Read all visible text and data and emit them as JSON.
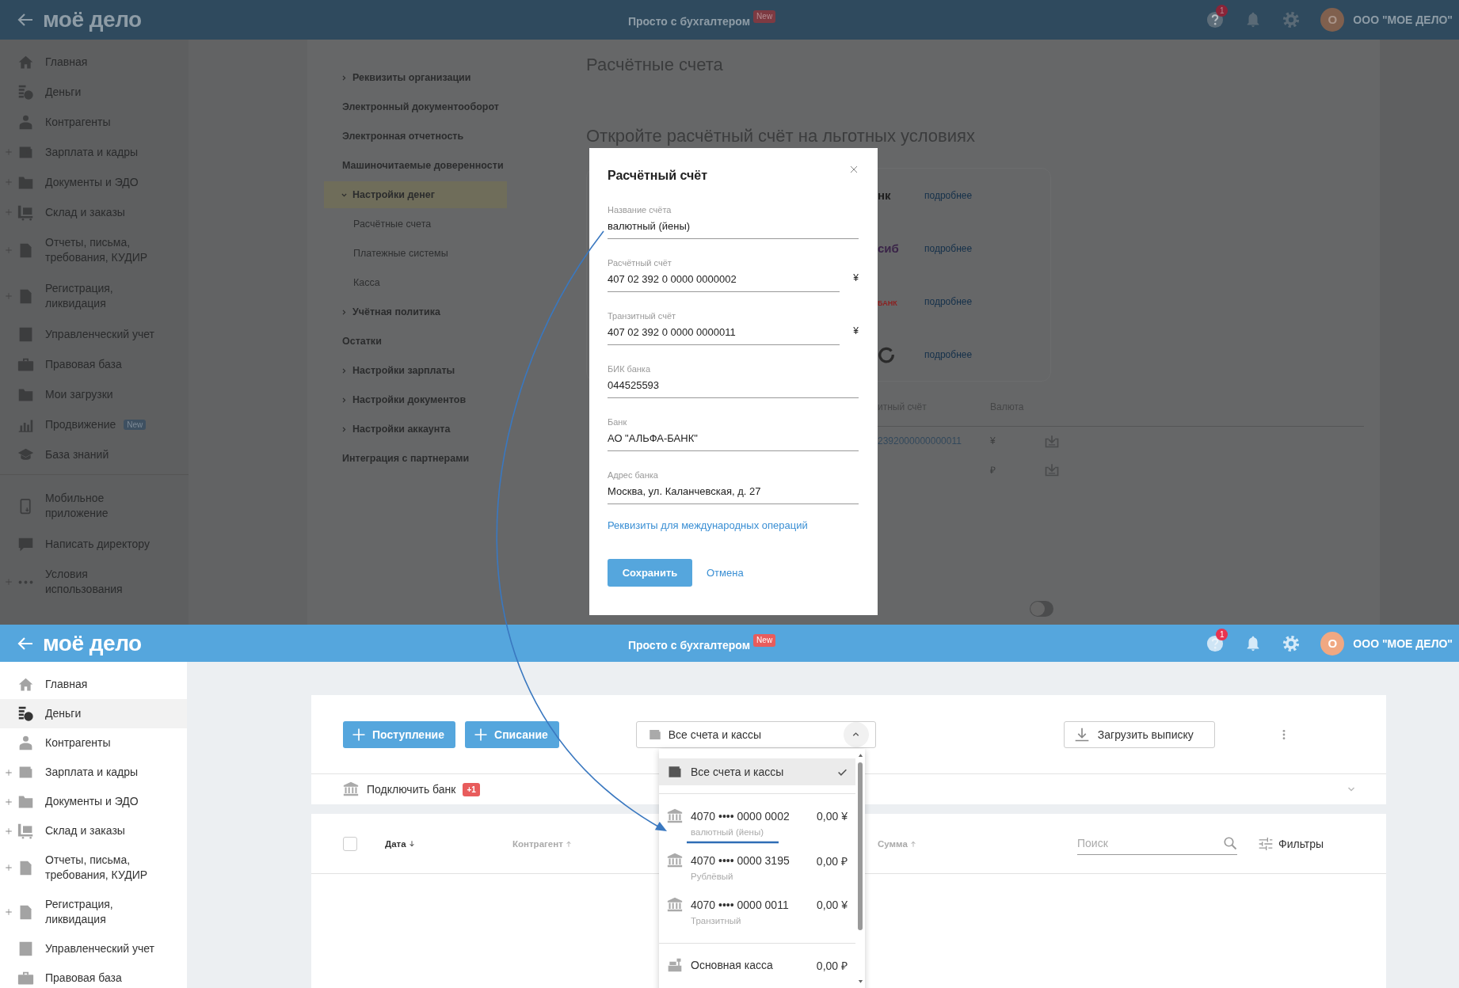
{
  "background_screen": {
    "header": {
      "logo": "моё дело",
      "promo": "Просто с бухгалтером",
      "promo_badge": "New",
      "help_badge": "1",
      "avatar_letter": "О",
      "company": "ООО \"МОЕ ДЕЛО\""
    },
    "sidebar": {
      "items": [
        {
          "label": "Главная",
          "expandable": false
        },
        {
          "label": "Деньги",
          "expandable": false
        },
        {
          "label": "Контрагенты",
          "expandable": false
        },
        {
          "label": "Зарплата и кадры",
          "expandable": true
        },
        {
          "label": "Документы и ЭДО",
          "expandable": true
        },
        {
          "label": "Склад и заказы",
          "expandable": true
        },
        {
          "label": "Отчеты, письма, требования, КУДИР",
          "expandable": true
        },
        {
          "label": "Регистрация, ликвидация",
          "expandable": true
        },
        {
          "label": "Управленческий учет",
          "expandable": false
        },
        {
          "label": "Правовая база",
          "expandable": false
        },
        {
          "label": "Мои загрузки",
          "expandable": false
        },
        {
          "label": "Продвижение",
          "expandable": false,
          "badge": "New"
        },
        {
          "label": "База знаний",
          "expandable": false
        }
      ],
      "footer_items": [
        {
          "label": "Мобильное приложение",
          "expandable": false
        },
        {
          "label": "Написать директору",
          "expandable": false
        },
        {
          "label": "Условия использования",
          "expandable": true
        }
      ]
    },
    "settings_nav": {
      "items": [
        {
          "label": "Реквизиты организации",
          "expanded": false,
          "selected": false
        },
        {
          "label": "Электронный документооборот",
          "selected": false
        },
        {
          "label": "Электронная отчетность",
          "selected": false
        },
        {
          "label": "Машиночитаемые доверенности",
          "selected": false
        },
        {
          "label": "Настройки денег",
          "expanded": true,
          "selected": true,
          "children": [
            {
              "label": "Расчётные счета",
              "selected": false
            },
            {
              "label": "Платежные системы",
              "selected": false
            },
            {
              "label": "Касса",
              "selected": false
            }
          ]
        },
        {
          "label": "Учётная политика",
          "expanded": false,
          "selected": false
        },
        {
          "label": "Остатки",
          "selected": false
        },
        {
          "label": "Настройки зарплаты",
          "expanded": false,
          "selected": false
        },
        {
          "label": "Настройки документов",
          "expanded": false,
          "selected": false
        },
        {
          "label": "Настройки аккаунта",
          "expanded": false,
          "selected": false
        },
        {
          "label": "Интеграция с партнерами",
          "selected": false
        }
      ]
    },
    "page": {
      "title": "Расчётные счета",
      "offer_title": "Откройте расчётный счёт на льготных условиях",
      "bank_offers": [
        {
          "kind": "text",
          "logo": "нк",
          "color": "#1f1f1f",
          "link": "подробнее"
        },
        {
          "kind": "text",
          "logo": "сиб",
          "color": "#3a2448",
          "link": "подробнее"
        },
        {
          "kind": "text",
          "logo": "БАНК",
          "color": "#8b2020",
          "link": "подробнее"
        },
        {
          "kind": "mark",
          "link": "подробнее"
        }
      ],
      "accounts_table": {
        "columns": [
          "итный счёт",
          "Валюта"
        ],
        "rows": [
          {
            "column_2": "2392000000000011",
            "column_3": "¥"
          },
          {
            "column_3": "₽"
          }
        ]
      },
      "toggle_row": {
        "on": false
      }
    }
  },
  "modal": {
    "title": "Расчётный счёт",
    "fields": [
      {
        "label": "Название счёта",
        "value": "валютный (йены)"
      },
      {
        "label": "Расчётный счёт",
        "value": "407 02 392 0 0000 0000002",
        "currency": "¥"
      },
      {
        "label": "Транзитный счёт",
        "value": "407 02 392 0 0000 0000011",
        "currency": "¥"
      },
      {
        "label": "БИК банка",
        "value": "044525593"
      },
      {
        "label": "Банк",
        "value": "АО \"АЛЬФА-БАНК\""
      },
      {
        "label": "Адрес банка",
        "value": "Москва, ул. Каланчевская, д. 27"
      }
    ],
    "link": "Реквизиты для международных операций",
    "save_button": "Сохранить",
    "cancel_button": "Отмена"
  },
  "foreground_screen": {
    "header": {
      "logo": "моё дело",
      "promo": "Просто с бухгалтером",
      "promo_badge": "New",
      "help_badge": "1",
      "avatar_letter": "О",
      "company": "ООО \"МОЕ ДЕЛО\""
    },
    "sidebar": {
      "items": [
        {
          "label": "Главная",
          "expandable": false,
          "selected": false
        },
        {
          "label": "Деньги",
          "expandable": false,
          "selected": true
        },
        {
          "label": "Контрагенты",
          "expandable": false,
          "selected": false
        },
        {
          "label": "Зарплата и кадры",
          "expandable": true,
          "selected": false
        },
        {
          "label": "Документы и ЭДО",
          "expandable": true,
          "selected": false
        },
        {
          "label": "Склад и заказы",
          "expandable": true,
          "selected": false
        },
        {
          "label": "Отчеты, письма, требования, КУДИР",
          "expandable": true,
          "selected": false
        },
        {
          "label": "Регистрация, ликвидация",
          "expandable": true,
          "selected": false
        },
        {
          "label": "Управленческий учет",
          "expandable": false,
          "selected": false
        },
        {
          "label": "Правовая база",
          "expandable": false,
          "selected": false
        }
      ]
    },
    "toolbar": {
      "income_button": "Поступление",
      "expense_button": "Списание",
      "account_select": {
        "value": "Все счета и кассы",
        "expanded": true
      },
      "upload_button": "Загрузить выписку"
    },
    "bank_connect": {
      "label": "Подключить банк",
      "badge": "+1",
      "expanded": false
    },
    "table": {
      "select_all_checked": false,
      "columns": [
        {
          "label": "Дата",
          "sort_descending": true,
          "active": true
        },
        {
          "label": "Контрагент",
          "sort_descending": false,
          "active": false
        },
        {
          "label": "Сумма",
          "sort_descending": false,
          "active": false
        }
      ],
      "search_placeholder": "Поиск",
      "filters_button": "Фильтры"
    },
    "account_menu": {
      "items": [
        {
          "kind": "all",
          "label": "Все счета и кассы",
          "selected": true
        },
        {
          "kind": "account",
          "number": "4070 •••• 0000 0002",
          "amount": "0,00 ¥",
          "note": "валютный (йены)",
          "selected": false
        },
        {
          "kind": "account",
          "number": "4070 •••• 0000 3195",
          "amount": "0,00 ₽",
          "note": "Рублёвый",
          "selected": false
        },
        {
          "kind": "account",
          "number": "4070 •••• 0000 0011",
          "amount": "0,00 ¥",
          "note": "Транзитный",
          "selected": false
        },
        {
          "kind": "cash",
          "label": "Основная касса",
          "amount": "0,00 ₽",
          "selected": false
        }
      ]
    }
  }
}
